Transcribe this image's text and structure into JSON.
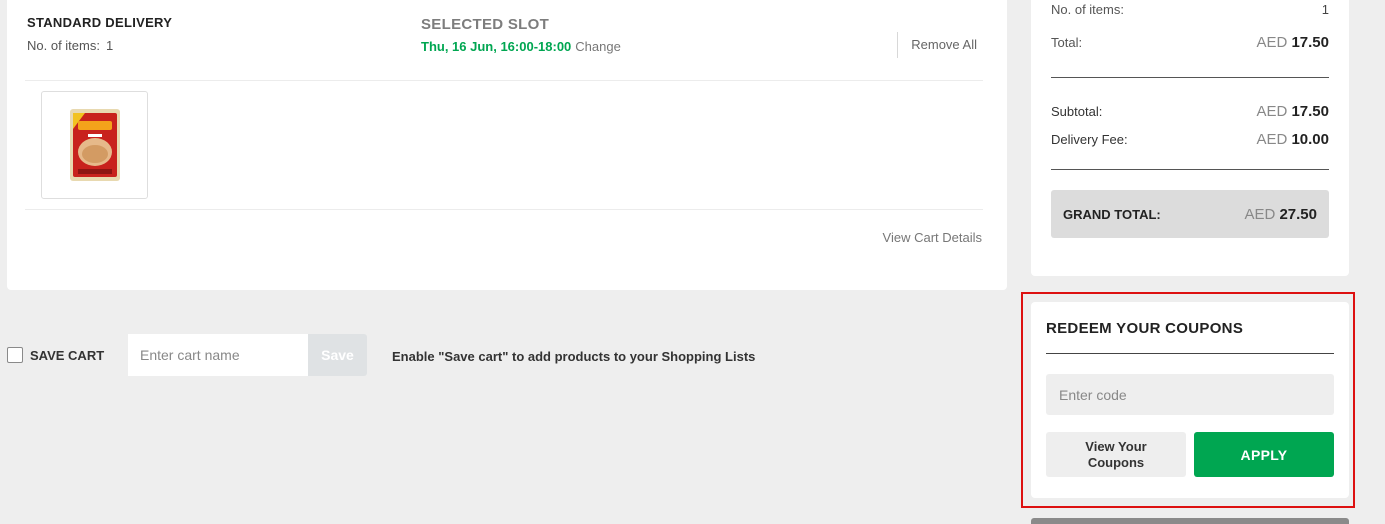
{
  "delivery": {
    "type": "STANDARD DELIVERY",
    "items_label": "No. of items:",
    "items_count": "1",
    "slot_heading": "SELECTED SLOT",
    "slot_time": "Thu, 16 Jun, 16:00-18:00",
    "change_label": "Change",
    "remove_all_label": "Remove All",
    "view_cart_label": "View Cart Details"
  },
  "save_cart": {
    "label": "SAVE CART",
    "checked": false,
    "input_placeholder": "Enter cart name",
    "button_label": "Save",
    "hint": "Enable \"Save cart\" to add products to your Shopping Lists"
  },
  "summary": {
    "items_label": "No. of items:",
    "items_count": "1",
    "total_label": "Total:",
    "currency": "AED",
    "total_value": "17.50",
    "subtotal_label": "Subtotal:",
    "subtotal_value": "17.50",
    "delivery_fee_label": "Delivery Fee:",
    "delivery_fee_value": "10.00",
    "grand_total_label": "GRAND TOTAL:",
    "grand_total_value": "27.50"
  },
  "coupons": {
    "title": "REDEEM YOUR COUPONS",
    "code_placeholder": "Enter code",
    "view_label": "View Your Coupons",
    "apply_label": "APPLY"
  },
  "colors": {
    "accent_green": "#00a651",
    "highlight_red": "#dd1111"
  },
  "icons": {
    "product": "flour-bag-icon"
  }
}
